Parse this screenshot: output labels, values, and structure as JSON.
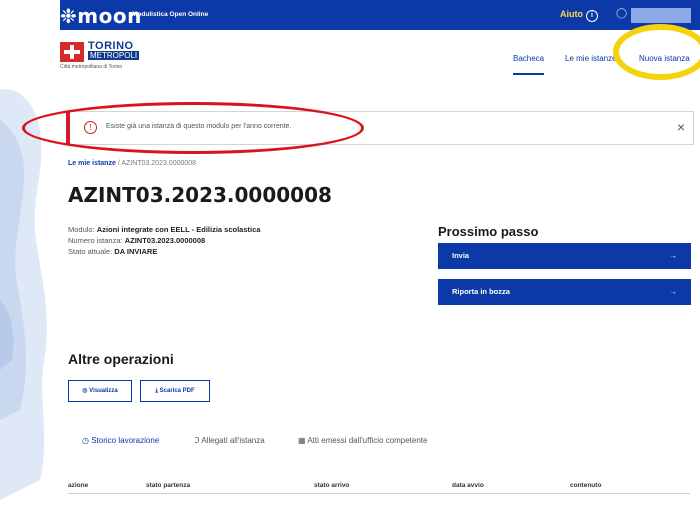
{
  "topbar": {
    "logo": "❉moon",
    "subtitle": "Modulistica Open Online",
    "help": "Aiuto",
    "help_icon": "info-icon"
  },
  "header": {
    "brand": {
      "line1": "TORINO",
      "line2": "METROPOLI",
      "line3": "Città metropolitana di Torino"
    },
    "nav": [
      "Bacheca",
      "Le mie istanze",
      "Nuova istanza"
    ]
  },
  "alert": {
    "text": "Esiste già una istanza di questo modulo per l'anno corrente.",
    "close": "×"
  },
  "breadcrumb": {
    "link": "Le mie istanze",
    "sep": "/",
    "current": "AZINT03.2023.0000008"
  },
  "title": "AZINT03.2023.0000008",
  "meta": {
    "modulo_label": "Modulo: ",
    "modulo_value": "Azioni integrate con EELL - Edilizia scolastica",
    "numero_label": "Numero istanza: ",
    "numero_value": "AZINT03.2023.0000008",
    "stato_label": "Stato attuale: ",
    "stato_value": "DA INVIARE"
  },
  "next": {
    "title": "Prossimo passo",
    "btn1": "Invia",
    "btn2": "Riporta in bozza",
    "arrow": "→"
  },
  "other": {
    "title": "Altre operazioni",
    "btn_view": "Visualizza",
    "btn_pdf": "Scarica PDF"
  },
  "tabs": [
    "Storico lavorazione",
    "Allegati all'istanza",
    "Atti emessi dall'ufficio competente"
  ],
  "table": {
    "columns": [
      "azione",
      "stato partenza",
      "stato arrivo",
      "data avvio",
      "contenuto"
    ]
  }
}
